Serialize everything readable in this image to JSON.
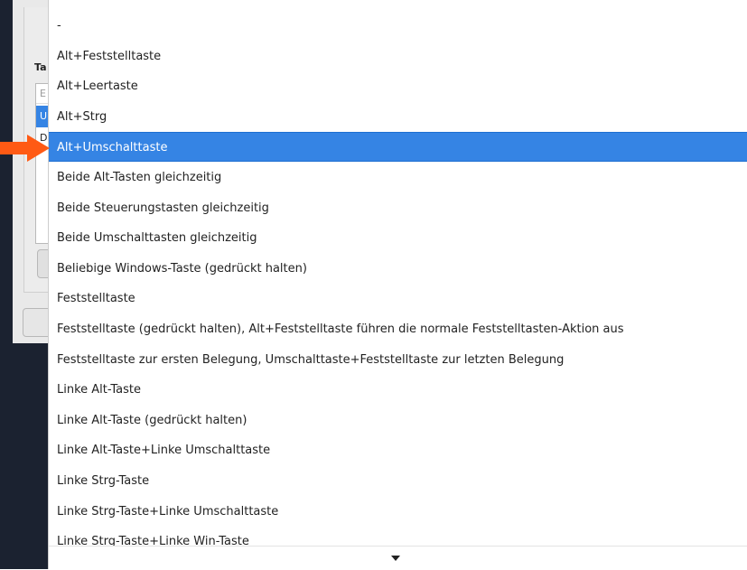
{
  "dialog": {
    "group_label": "Ta",
    "list": {
      "header": "E",
      "selected_row": "U",
      "row2": "D"
    }
  },
  "popup": {
    "items": [
      "-",
      "Alt+Feststelltaste",
      "Alt+Leertaste",
      "Alt+Strg",
      "Alt+Umschalttaste",
      "Beide Alt-Tasten gleichzeitig",
      "Beide Steuerungstasten gleichzeitig",
      "Beide Umschalttasten gleichzeitig",
      "Beliebige Windows-Taste (gedrückt halten)",
      "Feststelltaste",
      "Feststelltaste (gedrückt halten), Alt+Feststelltaste führen die normale Feststelltasten-Aktion aus",
      "Feststelltaste zur ersten Belegung, Umschalttaste+Feststelltaste zur letzten Belegung",
      "Linke Alt-Taste",
      "Linke Alt-Taste (gedrückt halten)",
      "Linke Alt-Taste+Linke Umschalttaste",
      "Linke Strg-Taste",
      "Linke Strg-Taste+Linke Umschalttaste",
      "Linke Strg-Taste+Linke Win-Taste"
    ],
    "selected_index": 4,
    "scroll_icon": "chevron-down-icon"
  },
  "annotation": {
    "arrow_color": "#ff5a14",
    "arrow_icon": "arrow-right-icon"
  },
  "colors": {
    "selection": "#3584e4",
    "desktop": "#1b2230"
  }
}
